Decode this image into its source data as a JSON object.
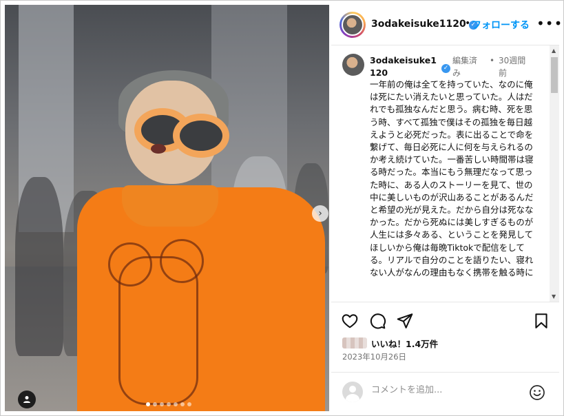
{
  "header": {
    "username": "3odakeisuke1120",
    "separator": "•",
    "follow_label": "フォローする",
    "more_label": "•••"
  },
  "caption": {
    "username": "3odakeisuke1120",
    "edited": "編集済み",
    "separator": "•",
    "time": "30週間前",
    "text": "一年前の俺は全てを持っていた、なのに俺は死にたい消えたいと思っていた。人はだれでも孤独なんだと思う。病む時、死を思う時、すべて孤独で僕はその孤独を毎日越えようと必死だった。表に出ることで命を繋げて、毎日必死に人に何を与えられるのか考え続けていた。一番苦しい時間帯は寝る時だった。本当にもう無理だなって思った時に、ある人のストーリーを見て、世の中に美しいものが沢山あることがあるんだと希望の光が見えた。だから自分は死ななかった。だから死ぬには美しすぎるものが人生には多々ある、ということを発見してほしいから俺は毎晩Tiktokで配信をしてる。リアルで自分のことを語りたい、寝れない人がなんの理由もなく携帯を触る時に"
  },
  "likes": {
    "text": "いいね！1.4万件"
  },
  "post_date": "2023年10月26日",
  "comment": {
    "placeholder": "コメントを追加..."
  },
  "carousel": {
    "current": 1,
    "total": 7
  },
  "icons": {
    "verified": "verified-badge-icon",
    "like": "heart-icon",
    "comment": "comment-bubble-icon",
    "share": "paper-plane-icon",
    "save": "bookmark-icon",
    "emoji": "smiley-icon",
    "next": "chevron-right-icon",
    "user_tag": "person-icon"
  },
  "colors": {
    "accent": "#0095f6",
    "verified": "#3897f0",
    "text": "#111111",
    "muted": "#737373"
  }
}
